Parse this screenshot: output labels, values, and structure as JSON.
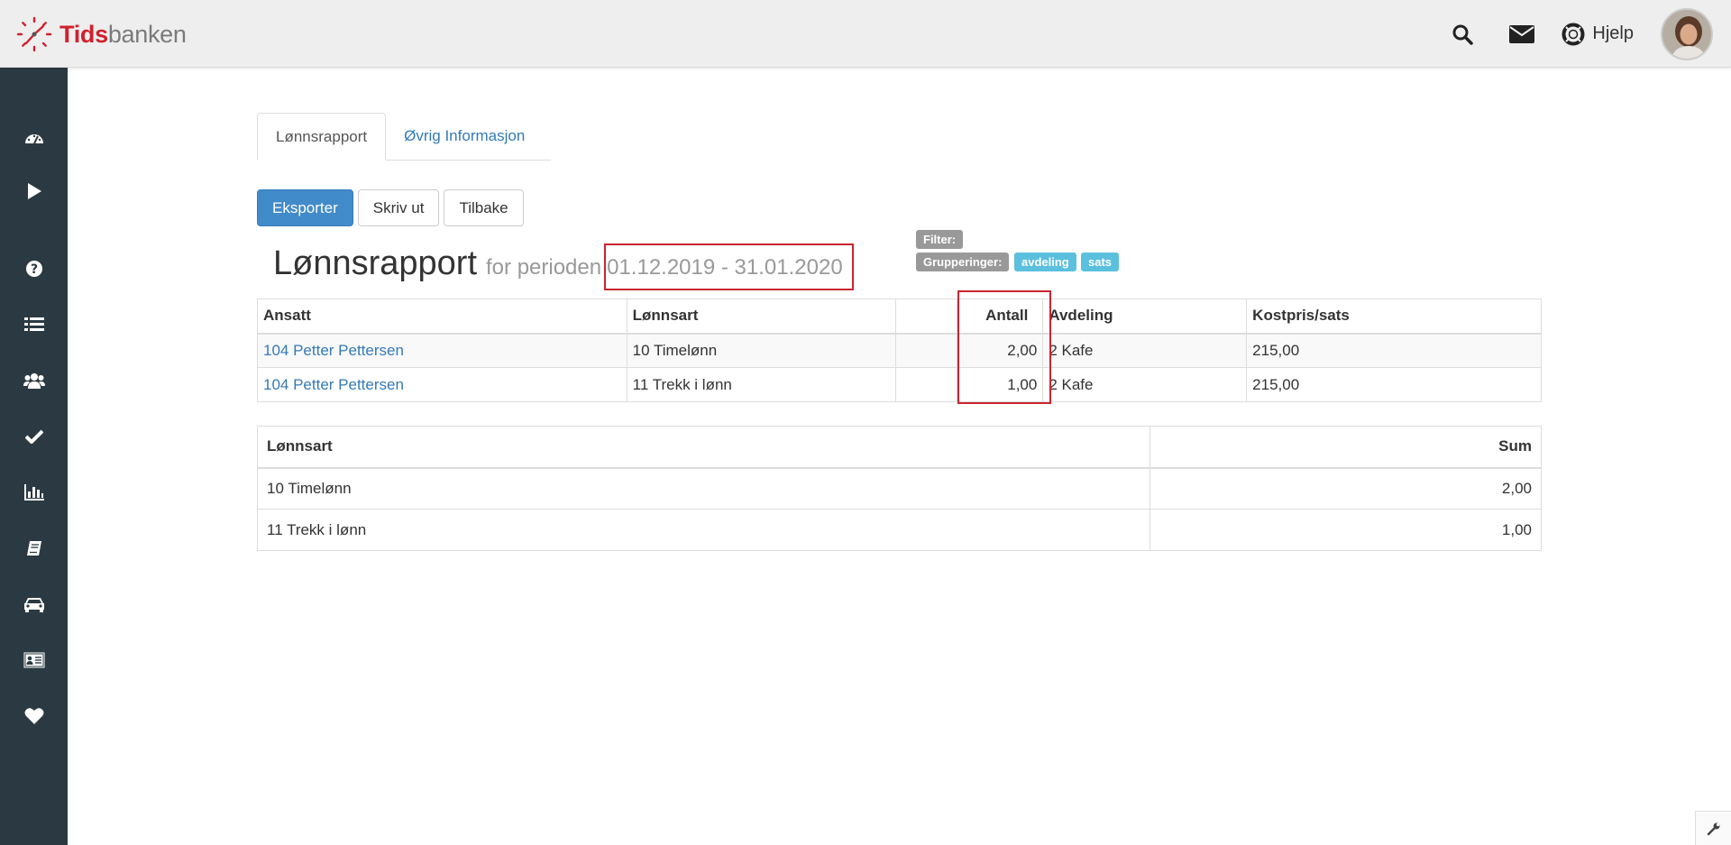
{
  "app": {
    "logo_part1": "Tids",
    "logo_part2": "banken"
  },
  "topnav": {
    "help_label": "Hjelp"
  },
  "sidebar": {
    "items": [
      {
        "icon": "dashboard-icon"
      },
      {
        "icon": "play-icon"
      },
      {
        "icon": "question-icon"
      },
      {
        "icon": "list-icon"
      },
      {
        "icon": "users-icon"
      },
      {
        "icon": "check-icon"
      },
      {
        "icon": "bar-chart-icon"
      },
      {
        "icon": "book-icon"
      },
      {
        "icon": "car-icon"
      },
      {
        "icon": "id-card-icon"
      },
      {
        "icon": "heart-icon"
      }
    ]
  },
  "tabs": {
    "active": "Lønnsrapport",
    "other": "Øvrig Informasjon"
  },
  "toolbar": {
    "export": "Eksporter",
    "print": "Skriv ut",
    "back": "Tilbake"
  },
  "report": {
    "title": "Lønnsrapport",
    "subtitle": "for perioden",
    "period": "01.12.2019 - 31.01.2020"
  },
  "labels": {
    "filter": "Filter:",
    "groupings": "Grupperinger:",
    "tag1": "avdeling",
    "tag2": "sats"
  },
  "detail_table": {
    "headers": [
      "Ansatt",
      "Lønnsart",
      "",
      "Antall",
      "Avdeling",
      "Kostpris/sats"
    ],
    "rows": [
      [
        "104 Petter Pettersen",
        "10 Timelønn",
        "",
        "2,00",
        "2 Kafe",
        "215,00"
      ],
      [
        "104 Petter Pettersen",
        "11 Trekk i lønn",
        "",
        "1,00",
        "2 Kafe",
        "215,00"
      ]
    ]
  },
  "summary_table": {
    "headers": [
      "Lønnsart",
      "Sum"
    ],
    "rows": [
      [
        "10 Timelønn",
        "2,00"
      ],
      [
        "11 Trekk i lønn",
        "1,00"
      ]
    ]
  },
  "colors": {
    "sidebar": "#2b3a42",
    "primary": "#428bca",
    "link": "#337ab7",
    "highlight": "#c9252f",
    "info": "#5bc0de"
  }
}
